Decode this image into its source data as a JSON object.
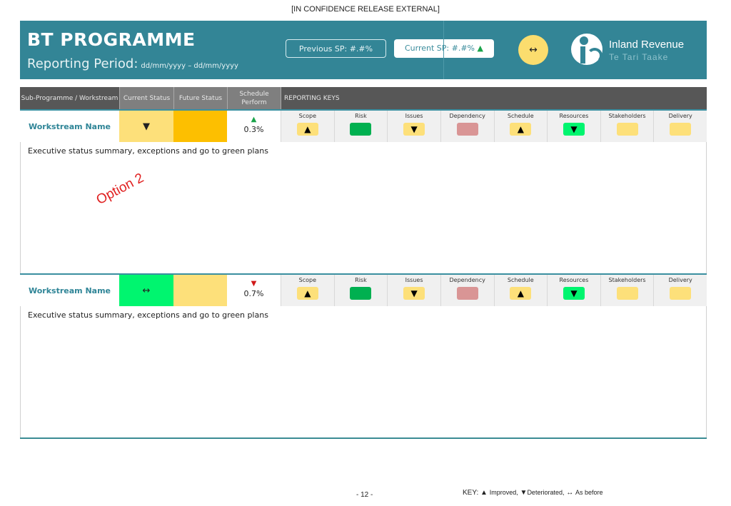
{
  "classification": "[IN CONFIDENCE RELEASE EXTERNAL]",
  "banner": {
    "title": "BT PROGRAMME",
    "period_label": "Reporting Period:",
    "period_dates": "dd/mm/yyyy – dd/mm/yyyy",
    "previous_sp": "Previous SP: #.#%",
    "current_sp": "Current SP: #.#%",
    "current_sp_trend": "▲",
    "overall_trend": "↔",
    "logo_name": "Inland Revenue",
    "logo_maori": "Te Tari Taake"
  },
  "table_header": {
    "col_workstream": "Sub-Programme / Workstream",
    "col_current": "Current Status",
    "col_future": "Future Status",
    "col_schedule": "Schedule Perform",
    "col_keys": "REPORTING KEYS"
  },
  "workstreams": [
    {
      "name": "Workstream Name",
      "current_status_symbol": "▼",
      "current_status_color": "#fde07a",
      "future_status_color": "#fdbf00",
      "schedule_arrow": "▲",
      "schedule_arrow_color": "#1aa34a",
      "schedule_value": "0.3%",
      "summary": "Executive status summary, exceptions and go to green plans",
      "keys": [
        {
          "label": "Scope",
          "symbol": "▲",
          "color": "#fde07a"
        },
        {
          "label": "Risk",
          "symbol": "",
          "color": "#00b050"
        },
        {
          "label": "Issues",
          "symbol": "▼",
          "color": "#fde07a"
        },
        {
          "label": "Dependency",
          "symbol": "",
          "color": "#d99595"
        },
        {
          "label": "Schedule",
          "symbol": "▲",
          "color": "#fde07a"
        },
        {
          "label": "Resources",
          "symbol": "▼",
          "color": "#00f56f"
        },
        {
          "label": "Stakeholders",
          "symbol": "",
          "color": "#fde07a"
        },
        {
          "label": "Delivery",
          "symbol": "",
          "color": "#fde07a"
        }
      ]
    },
    {
      "name": "Workstream Name",
      "current_status_symbol": "↔",
      "current_status_color": "#00f56f",
      "future_status_color": "#fde07a",
      "schedule_arrow": "▼",
      "schedule_arrow_color": "#d01818",
      "schedule_value": "0.7%",
      "summary": "Executive status summary, exceptions and go to green plans",
      "keys": [
        {
          "label": "Scope",
          "symbol": "▲",
          "color": "#fde07a"
        },
        {
          "label": "Risk",
          "symbol": "",
          "color": "#00b050"
        },
        {
          "label": "Issues",
          "symbol": "▼",
          "color": "#fde07a"
        },
        {
          "label": "Dependency",
          "symbol": "",
          "color": "#d99595"
        },
        {
          "label": "Schedule",
          "symbol": "▲",
          "color": "#fde07a"
        },
        {
          "label": "Resources",
          "symbol": "▼",
          "color": "#00f56f"
        },
        {
          "label": "Stakeholders",
          "symbol": "",
          "color": "#fde07a"
        },
        {
          "label": "Delivery",
          "symbol": "",
          "color": "#fde07a"
        }
      ]
    }
  ],
  "annotation": "Option 2",
  "footer": {
    "page": "- 12 -",
    "key_label": "KEY:",
    "improved_symbol": "▲",
    "improved": "Improved,",
    "deteriorated_symbol": "▼",
    "deteriorated": "Deteriorated,",
    "as_before_symbol": "↔",
    "as_before": "As before"
  }
}
